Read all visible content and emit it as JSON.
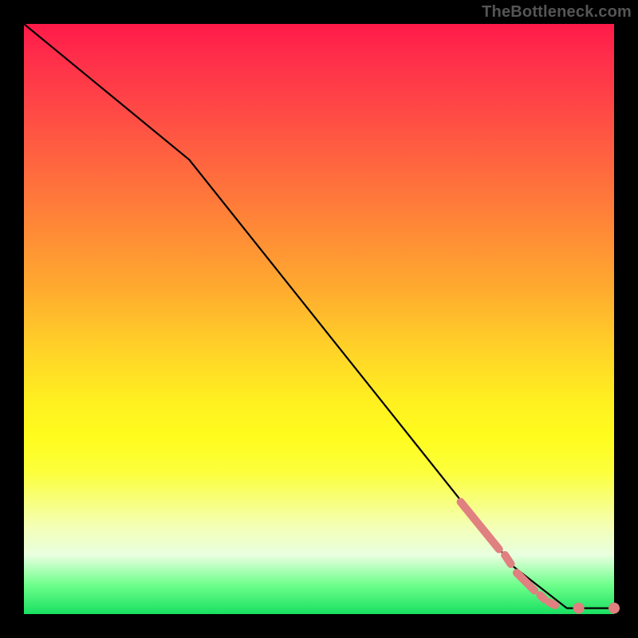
{
  "attribution": "TheBottleneck.com",
  "colors": {
    "dash_stroke": "#e08080",
    "curve_stroke": "#000000",
    "frame_bg": "#000000"
  },
  "chart_data": {
    "type": "line",
    "title": "",
    "xlabel": "",
    "ylabel": "",
    "xlim": [
      0,
      100
    ],
    "ylim": [
      0,
      100
    ],
    "grid": false,
    "legend": false,
    "series": [
      {
        "name": "curve",
        "x": [
          0,
          28,
          83,
          92,
          100
        ],
        "y": [
          100,
          77,
          8,
          1,
          1
        ],
        "style": "solid-black"
      }
    ],
    "dash_segments": [
      {
        "x0": 74.0,
        "y0": 19.0,
        "x1": 80.5,
        "y1": 11.0
      },
      {
        "x0": 81.5,
        "y0": 10.0,
        "x1": 82.5,
        "y1": 8.5
      },
      {
        "x0": 83.5,
        "y0": 7.0,
        "x1": 86.5,
        "y1": 4.0
      },
      {
        "x0": 87.5,
        "y0": 3.2,
        "x1": 88.2,
        "y1": 2.5
      },
      {
        "x0": 89.0,
        "y0": 2.0,
        "x1": 90.0,
        "y1": 1.5
      }
    ],
    "end_dots": [
      {
        "x": 94.0,
        "y": 1.0
      },
      {
        "x": 100.0,
        "y": 1.0
      }
    ]
  }
}
